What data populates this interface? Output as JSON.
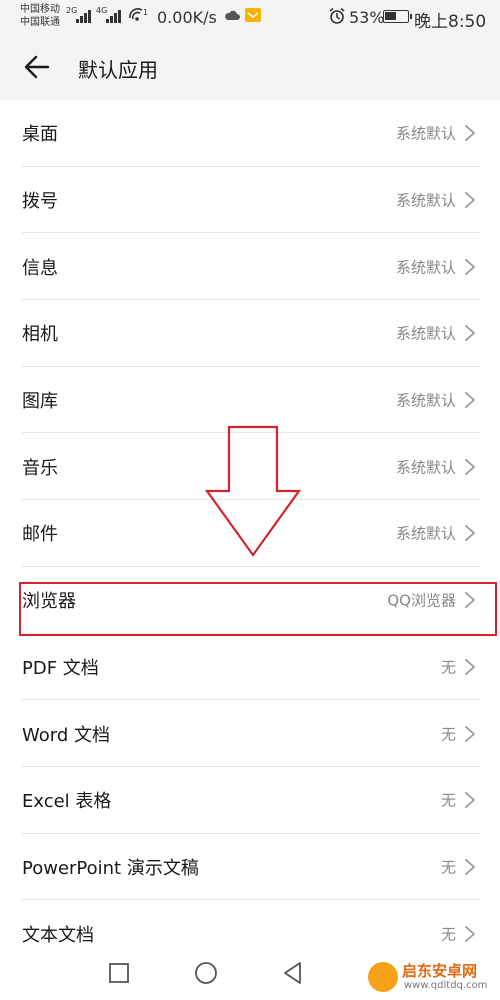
{
  "status_bar": {
    "carrier_1": "中国移动",
    "carrier_2": "中国联通",
    "sim1_network": "2G",
    "sim2_network": "4G",
    "hotspot_indicator": "1",
    "speed": "0.00K/s",
    "battery_percent": "53%",
    "battery_level": 0.53,
    "time": "晚上8:50"
  },
  "header": {
    "title": "默认应用"
  },
  "items": [
    {
      "label": "桌面",
      "value": "系统默认"
    },
    {
      "label": "拨号",
      "value": "系统默认"
    },
    {
      "label": "信息",
      "value": "系统默认"
    },
    {
      "label": "相机",
      "value": "系统默认"
    },
    {
      "label": "图库",
      "value": "系统默认"
    },
    {
      "label": "音乐",
      "value": "系统默认"
    },
    {
      "label": "邮件",
      "value": "系统默认"
    },
    {
      "label": "浏览器",
      "value": "QQ浏览器"
    },
    {
      "label": "PDF 文档",
      "value": "无"
    },
    {
      "label": "Word 文档",
      "value": "无"
    },
    {
      "label": "Excel 表格",
      "value": "无"
    },
    {
      "label": "PowerPoint 演示文稿",
      "value": "无"
    },
    {
      "label": "文本文档",
      "value": "无"
    }
  ],
  "watermark": {
    "name": "启东安卓网",
    "url": "www.qdltdq.com"
  },
  "colors": {
    "annotation_red": "#d4242f",
    "header_bg": "#f4f4f4",
    "value_gray": "#888888"
  },
  "icons": {
    "back": "arrow-left-icon",
    "chevron": "chevron-right-icon",
    "nav_recent": "square-icon",
    "nav_home": "circle-icon",
    "nav_back": "triangle-icon"
  }
}
